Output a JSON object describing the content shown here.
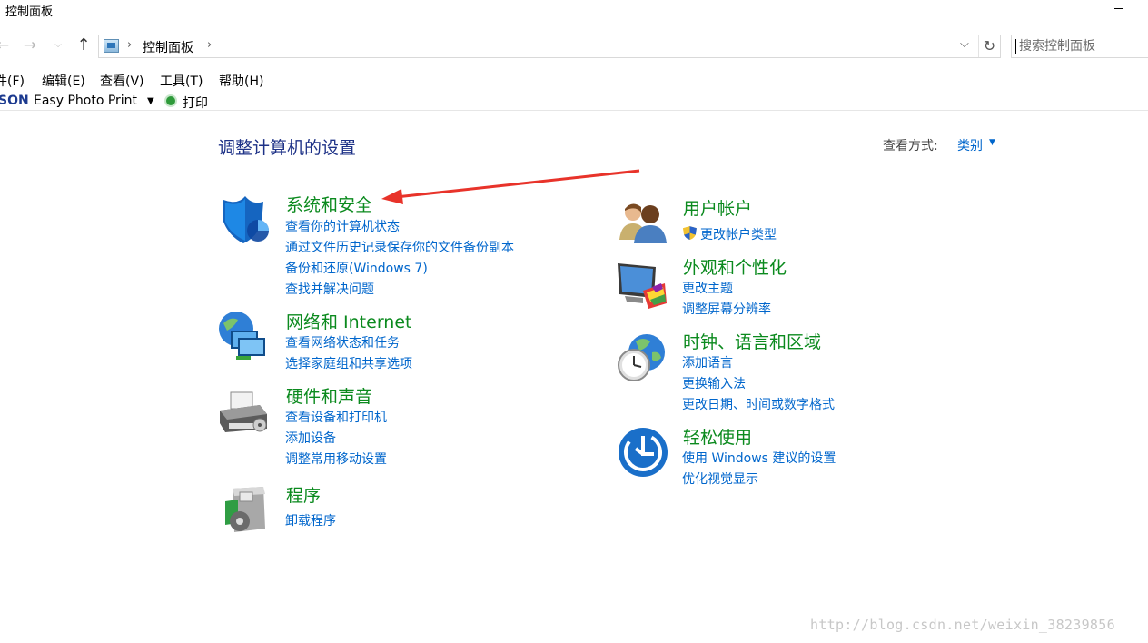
{
  "window": {
    "title": "控制面板"
  },
  "address": {
    "crumb": "控制面板",
    "separator": "›"
  },
  "search": {
    "placeholder": "搜索控制面板"
  },
  "menu": [
    "件(F)",
    "编辑(E)",
    "查看(V)",
    "工具(T)",
    "帮助(H)"
  ],
  "toolbar": {
    "logo": "SON",
    "app": "Easy Photo Print",
    "print": "打印"
  },
  "heading": "调整计算机的设置",
  "view_by": {
    "label": "查看方式:",
    "value": "类别"
  },
  "categories_left": [
    {
      "title": "系统和安全",
      "icon": "security-shield-icon",
      "links": [
        "查看你的计算机状态",
        "通过文件历史记录保存你的文件备份副本",
        "备份和还原(Windows 7)",
        "查找并解决问题"
      ]
    },
    {
      "title": "网络和 Internet",
      "icon": "network-globe-icon",
      "links": [
        "查看网络状态和任务",
        "选择家庭组和共享选项"
      ]
    },
    {
      "title": "硬件和声音",
      "icon": "printer-icon",
      "links": [
        "查看设备和打印机",
        "添加设备",
        "调整常用移动设置"
      ]
    },
    {
      "title": "程序",
      "icon": "programs-box-icon",
      "links": [
        "卸载程序"
      ]
    }
  ],
  "categories_right": [
    {
      "title": "用户帐户",
      "icon": "users-icon",
      "links": [
        "更改帐户类型"
      ]
    },
    {
      "title": "外观和个性化",
      "icon": "monitor-palette-icon",
      "links": [
        "更改主题",
        "调整屏幕分辨率"
      ]
    },
    {
      "title": "时钟、语言和区域",
      "icon": "clock-globe-icon",
      "links": [
        "添加语言",
        "更换输入法",
        "更改日期、时间或数字格式"
      ]
    },
    {
      "title": "轻松使用",
      "icon": "ease-of-access-icon",
      "links": [
        "使用 Windows 建议的设置",
        "优化视觉显示"
      ]
    }
  ],
  "watermark": "http://blog.csdn.net/weixin_38239856",
  "colors": {
    "category_title": "#0b8a1e",
    "link": "#0066cc",
    "heading": "#1e3287",
    "arrow": "#e8332a"
  }
}
